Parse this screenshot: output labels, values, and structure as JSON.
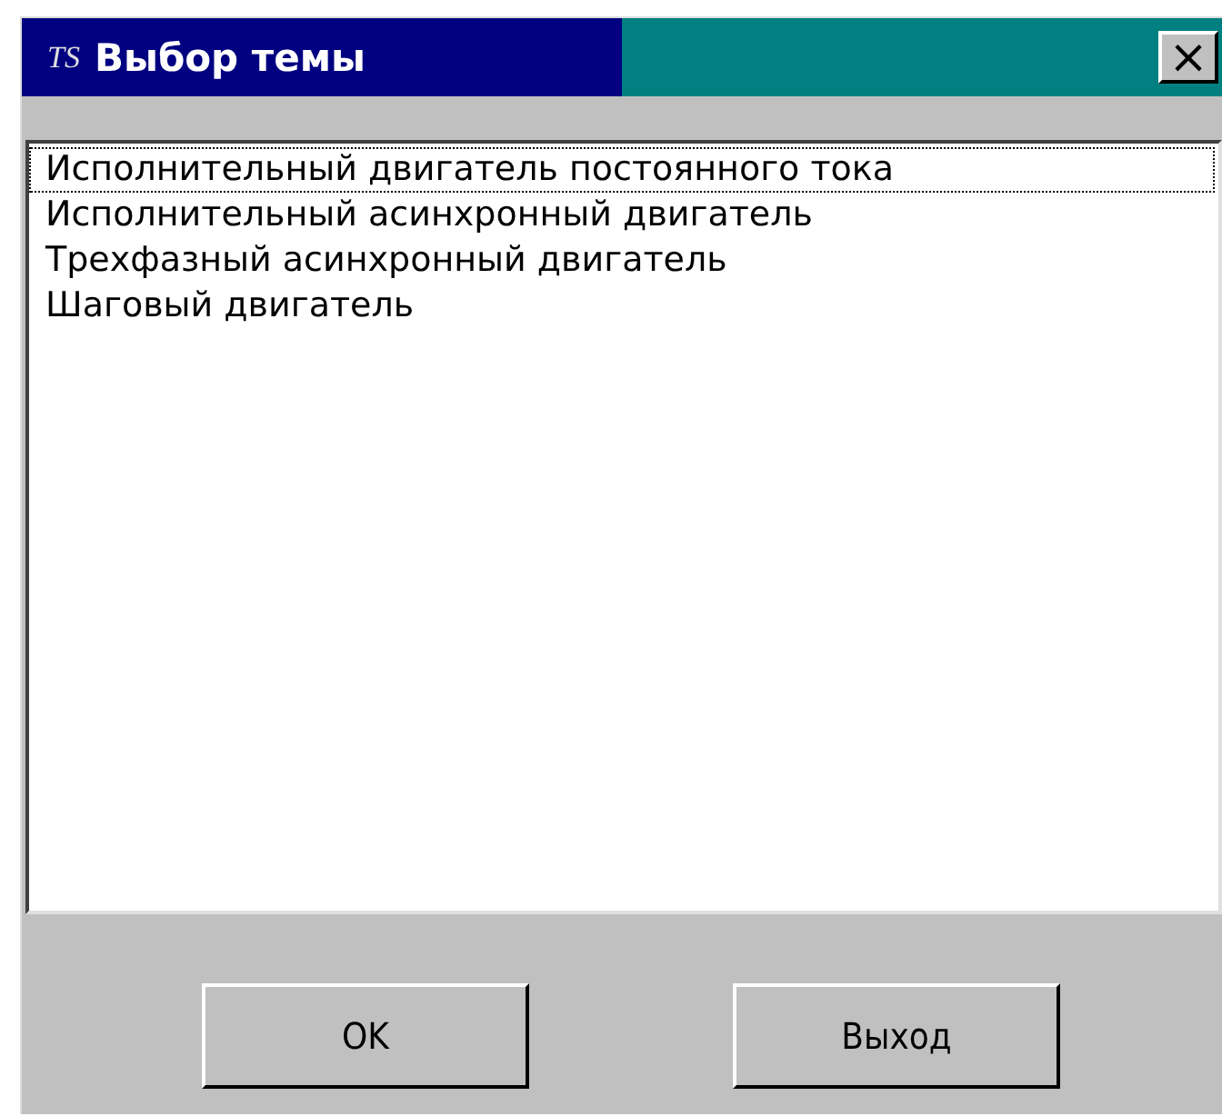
{
  "window": {
    "title_icon": "TS",
    "title": "Выбор темы",
    "close": "×"
  },
  "list": {
    "items": [
      {
        "label": "Исполнительный двигатель постоянного тока",
        "focused": true
      },
      {
        "label": "Исполнительный асинхронный двигатель",
        "focused": false
      },
      {
        "label": "Трехфазный асинхронный двигатель",
        "focused": false
      },
      {
        "label": "Шаговый двигатель",
        "focused": false
      }
    ]
  },
  "buttons": [
    "OK",
    "Выход"
  ]
}
